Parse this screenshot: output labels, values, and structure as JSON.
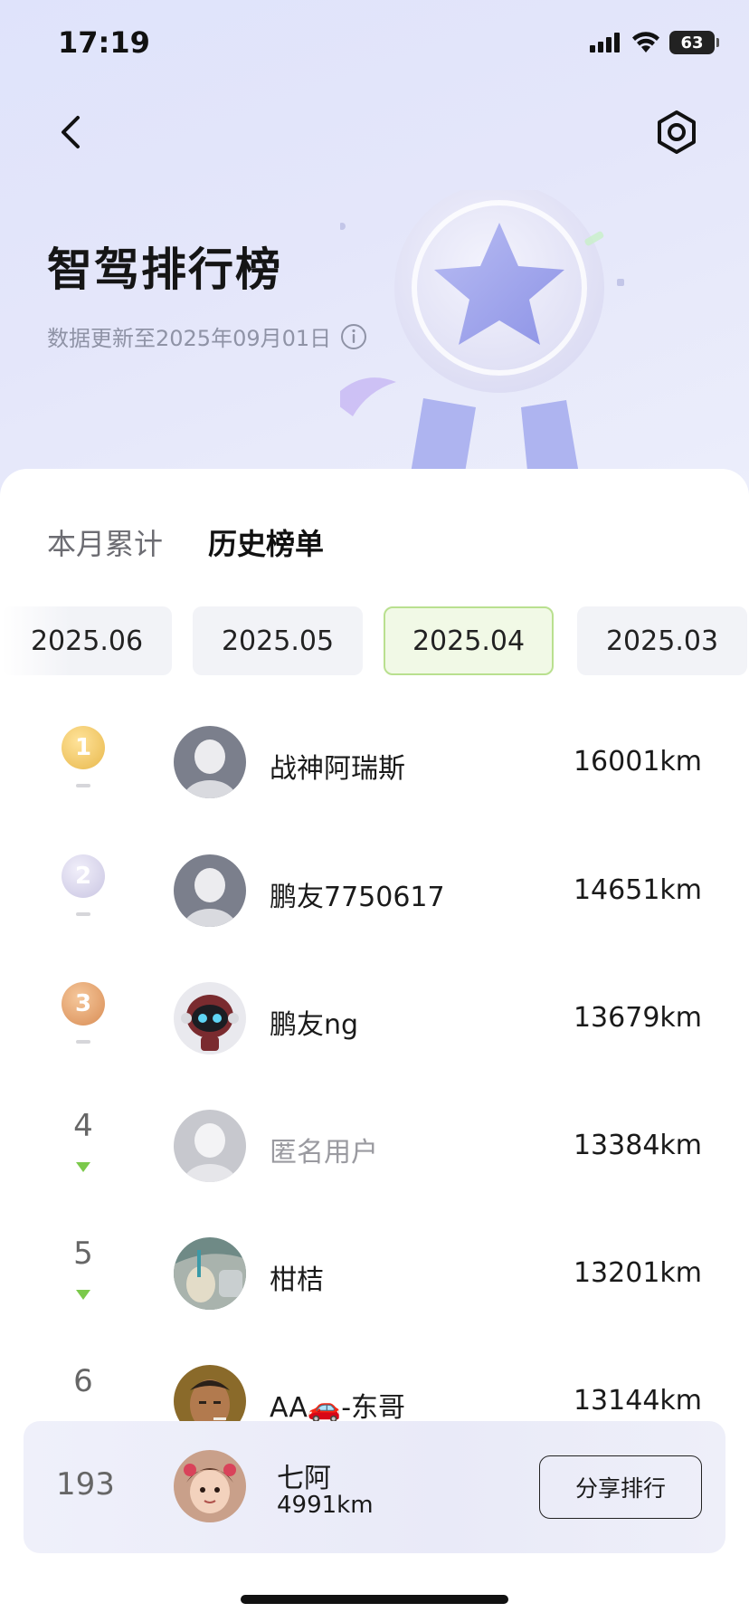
{
  "status_bar": {
    "time": "17:19",
    "battery": "63"
  },
  "header": {
    "title": "智驾排行榜",
    "update_text": "数据更新至2025年09月01日"
  },
  "tabs": [
    {
      "label": "本月累计",
      "active": false
    },
    {
      "label": "历史榜单",
      "active": true
    }
  ],
  "months": [
    {
      "label": "2025.06",
      "selected": false
    },
    {
      "label": "2025.05",
      "selected": false
    },
    {
      "label": "2025.04",
      "selected": true
    },
    {
      "label": "2025.03",
      "selected": false
    }
  ],
  "ranking": [
    {
      "rank": "1",
      "name": "战神阿瑞斯",
      "distance": "16001km",
      "trend": "flat",
      "medal": "gold",
      "avatar": "default"
    },
    {
      "rank": "2",
      "name": "鹏友7750617",
      "distance": "14651km",
      "trend": "flat",
      "medal": "silver",
      "avatar": "default"
    },
    {
      "rank": "3",
      "name": "鹏友ng",
      "distance": "13679km",
      "trend": "flat",
      "medal": "bronze",
      "avatar": "robot"
    },
    {
      "rank": "4",
      "name": "匿名用户",
      "distance": "13384km",
      "trend": "down",
      "medal": "",
      "avatar": "anonymous"
    },
    {
      "rank": "5",
      "name": "柑桔",
      "distance": "13201km",
      "trend": "down",
      "medal": "",
      "avatar": "photo-car"
    },
    {
      "rank": "6",
      "name": "AA🚗-东哥",
      "distance": "13144km",
      "trend": "flat",
      "medal": "",
      "avatar": "photo-man"
    }
  ],
  "my_rank": {
    "rank": "193",
    "name": "七阿",
    "distance": "4991km",
    "share_label": "分享排行"
  },
  "colors": {
    "accent_green": "#7bc94b",
    "selected_month_bg": "#f1f9e6",
    "selected_month_border": "#b9e08f",
    "hero_bg": "#dfe3fb"
  }
}
